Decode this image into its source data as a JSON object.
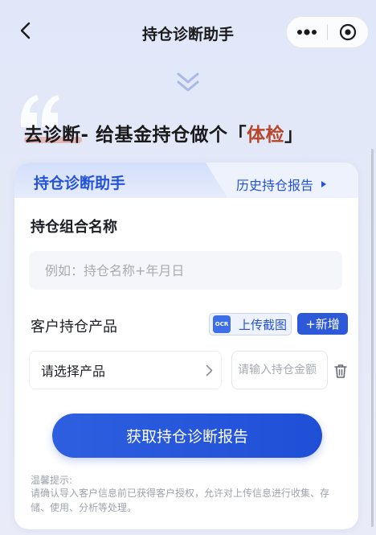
{
  "nav": {
    "title": "持仓诊断助手"
  },
  "headline": {
    "part1": "去诊断",
    "part2": "- 给基金持仓做个",
    "bracket_open": "「",
    "emphasis": "体检",
    "bracket_close": "」"
  },
  "card": {
    "tab_label": "持仓诊断助手",
    "history_link": "历史持仓报告",
    "portfolio_name_label": "持仓组合名称",
    "portfolio_name_placeholder": "例如：持仓名称+年月日",
    "products_label": "客户持仓产品",
    "upload_ocr_text": "OCR",
    "upload_label": "上传截图",
    "add_label": "+新增",
    "product_select_label": "请选择产品",
    "amount_placeholder": "请输入持仓金额",
    "submit_label": "获取持仓诊断报告",
    "tips_title": "温馨提示:",
    "tips_body": "请确认导入客户信息前已获得客户授权，允许对上传信息进行收集、存储、使用、分析等处理。"
  },
  "colors": {
    "accent": "#2453d6",
    "button": "#2d59d9",
    "emphasis": "#b8462a"
  },
  "icons": {
    "back": "chevron-left-icon",
    "more": "more-dots-icon",
    "close": "target-close-icon",
    "scroll_hint": "double-chevron-down-icon",
    "quote": "quote-mark-icon",
    "arrow": "chevron-right-icon",
    "trash": "trash-icon"
  }
}
